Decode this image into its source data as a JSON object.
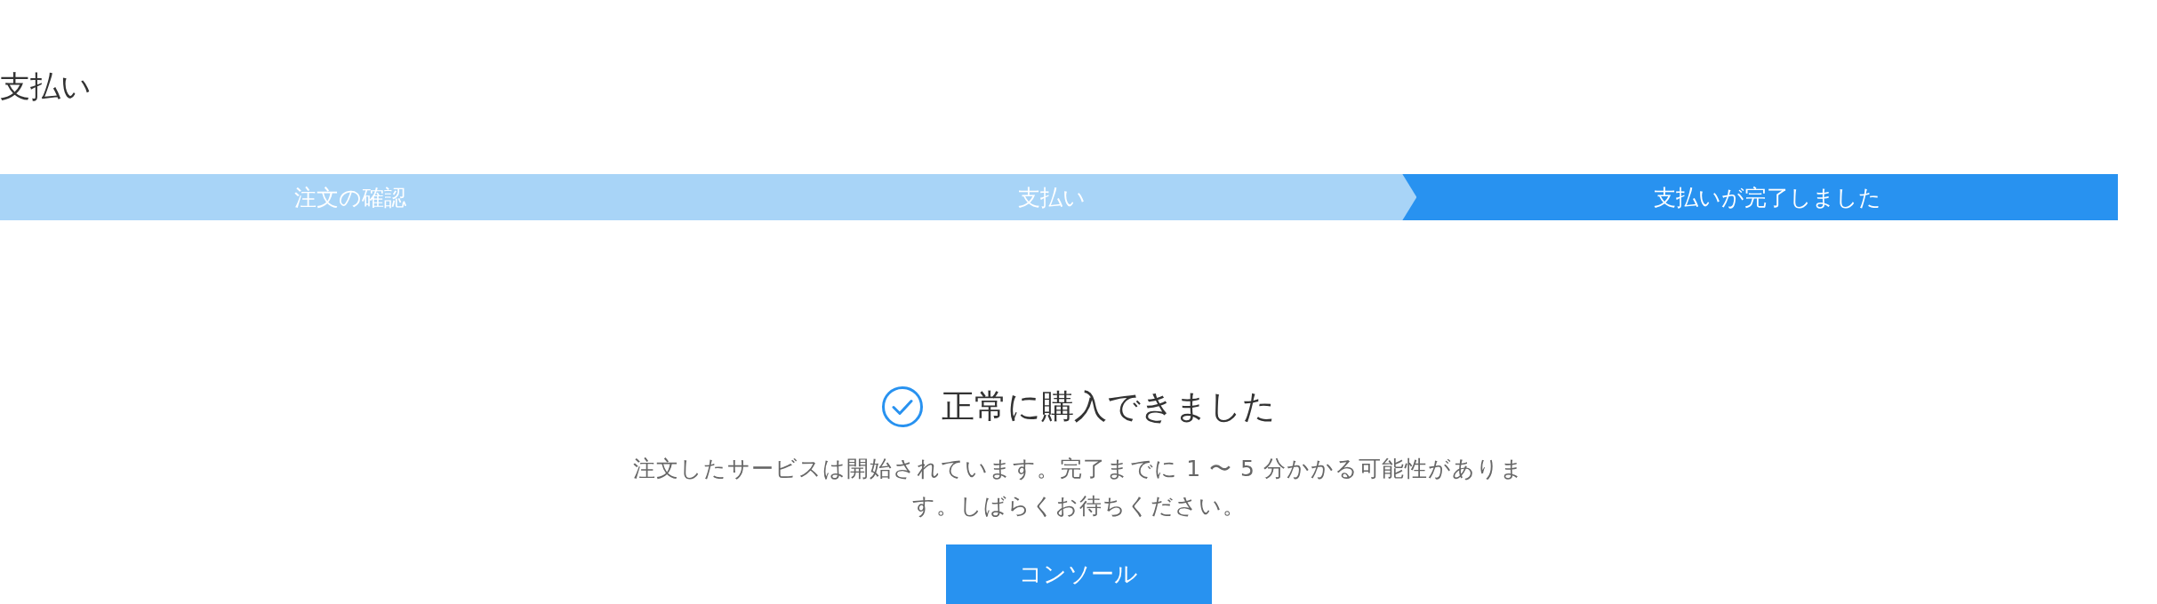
{
  "page_title": "支払い",
  "steps": [
    {
      "label": "注文の確認",
      "selected": false
    },
    {
      "label": "支払い",
      "selected": false
    },
    {
      "label": "支払いが完了しました",
      "selected": true
    }
  ],
  "result": {
    "heading": "正常に購入できました",
    "message": "注文したサービスは開始されています。完了までに 1 〜 5 分かかる可能性があります。しばらくお待ちください。",
    "button": "コンソール"
  }
}
